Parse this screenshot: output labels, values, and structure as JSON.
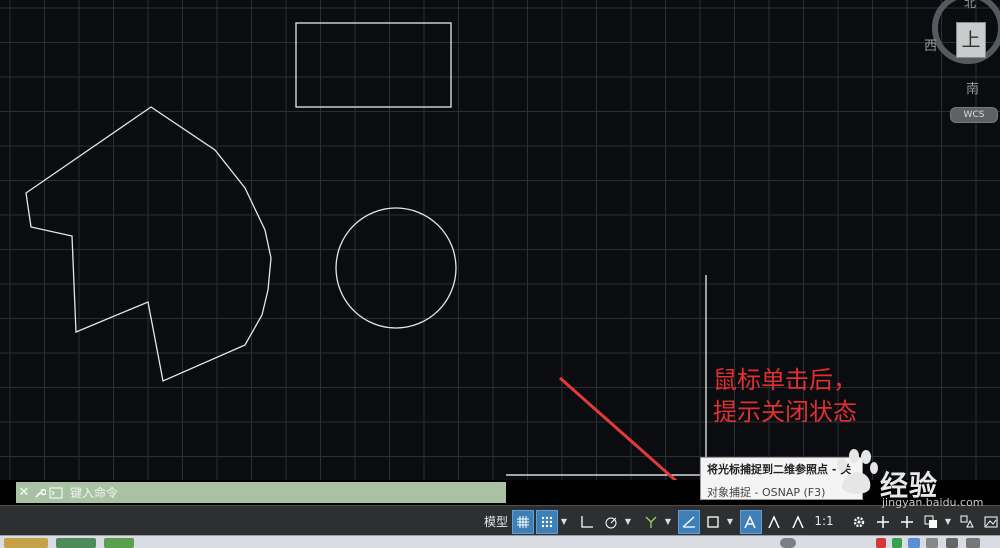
{
  "viewcube": {
    "north": "北",
    "west": "西",
    "south": "南",
    "face": "上",
    "wcs": "WCS"
  },
  "annotation": {
    "text": "鼠标单击后，\n提示关闭状态",
    "color": "#e03030"
  },
  "command_line": {
    "close_icon": "close-icon",
    "wrench_icon": "wrench-icon",
    "prompt_icon": "prompt-icon",
    "placeholder": "键入命令"
  },
  "status_bar": {
    "model_label": "模型",
    "buttons": [
      {
        "icon": "grid-display-icon",
        "active": true
      },
      {
        "icon": "snap-mode-icon",
        "active": true
      },
      {
        "icon": "ortho-icon",
        "active": false
      },
      {
        "icon": "polar-tracking-icon",
        "active": false
      },
      {
        "icon": "isometric-drafting-icon",
        "active": false
      },
      {
        "icon": "object-snap-tracking-icon",
        "active": true
      },
      {
        "icon": "object-snap-icon",
        "active": false
      },
      {
        "icon": "annotation-visibility-icon",
        "active": true
      },
      {
        "icon": "auto-scale-icon",
        "active": false
      },
      {
        "icon": "annotation-scale-icon",
        "active": false
      },
      {
        "icon": "workspace-gear-icon",
        "active": false
      },
      {
        "icon": "annotation-monitor-icon",
        "active": false
      },
      {
        "icon": "units-icon",
        "active": false
      },
      {
        "icon": "quick-properties-icon",
        "active": false
      },
      {
        "icon": "isolate-objects-icon",
        "active": false
      }
    ],
    "scale_label": "1:1"
  },
  "tooltip": {
    "title": "将光标捕捉到二维参照点 - 关",
    "subtitle": "对象捕捉 - OSNAP (F3)"
  },
  "watermark": {
    "brand": "经验",
    "url": "jingyan.baidu.com"
  },
  "colors": {
    "grid": "#2a2f36",
    "entity": "#e6e6e6",
    "arrow": "#e03a3a",
    "highlight": "#3e7fb6"
  }
}
